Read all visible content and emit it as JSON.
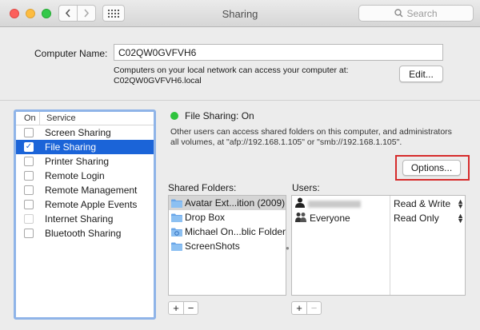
{
  "window": {
    "title": "Sharing"
  },
  "search": {
    "placeholder": "Search"
  },
  "computer_name": {
    "label": "Computer Name:",
    "value": "C02QW0GVFVH6",
    "note_line1": "Computers on your local network can access your computer at:",
    "note_line2": "C02QW0GVFVH6.local",
    "edit_label": "Edit..."
  },
  "services": {
    "header_on": "On",
    "header_service": "Service",
    "items": [
      {
        "label": "Screen Sharing",
        "checked": false
      },
      {
        "label": "File Sharing",
        "checked": true,
        "selected": true
      },
      {
        "label": "Printer Sharing",
        "checked": false
      },
      {
        "label": "Remote Login",
        "checked": false
      },
      {
        "label": "Remote Management",
        "checked": false
      },
      {
        "label": "Remote Apple Events",
        "checked": false
      },
      {
        "label": "Internet Sharing",
        "checked": false,
        "disabled": true
      },
      {
        "label": "Bluetooth Sharing",
        "checked": false
      }
    ]
  },
  "status": {
    "text": "File Sharing: On",
    "color": "#2ec33d",
    "desc_line1": "Other users can access shared folders on this computer, and administrators",
    "desc_line2": "all volumes, at \"afp://192.168.1.105\" or \"smb://192.168.1.105\"."
  },
  "options_label": "Options...",
  "shared_folders": {
    "label": "Shared Folders:",
    "items": [
      "Avatar Ext...ition (2009)",
      "Drop Box",
      "Michael On...blic Folder",
      "ScreenShots"
    ]
  },
  "users": {
    "label": "Users:",
    "rows": [
      {
        "name": "",
        "permission": "Read & Write"
      },
      {
        "name": "Everyone",
        "permission": "Read Only"
      }
    ]
  },
  "controls": {
    "add": "+",
    "remove": "−"
  },
  "colors": {
    "selection": "#1b64d8",
    "highlight_border": "#d62b2b",
    "focus_ring": "#8fb4e8"
  }
}
